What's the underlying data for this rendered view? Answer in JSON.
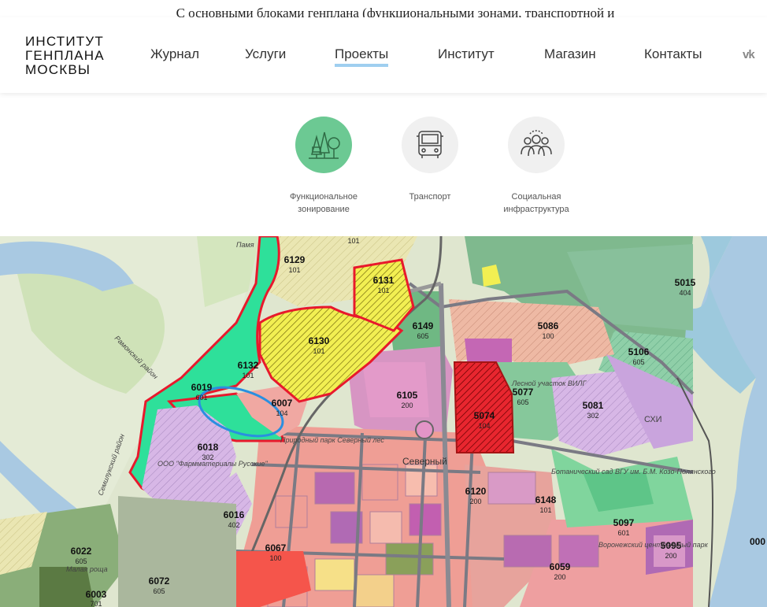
{
  "intro_text": "С основными блоками генплана (функциональными зонами, транспортной и",
  "logo": {
    "line1": "ИНСТИТУТ",
    "line2": "ГЕНПЛАНА",
    "line3": "МОСКВЫ"
  },
  "nav": [
    {
      "label": "Журнал",
      "active": false
    },
    {
      "label": "Услуги",
      "active": false
    },
    {
      "label": "Проекты",
      "active": true
    },
    {
      "label": "Институт",
      "active": false
    },
    {
      "label": "Магазин",
      "active": false
    },
    {
      "label": "Контакты",
      "active": false
    }
  ],
  "social": {
    "vk": "vk-icon"
  },
  "categories": [
    {
      "label": "Функциональное\nзонирование",
      "icon": "forest-icon",
      "active": true
    },
    {
      "label": "Транспорт",
      "icon": "bus-icon",
      "active": false
    },
    {
      "label": "Социальная\nинфраструктура",
      "icon": "people-icon",
      "active": false
    }
  ],
  "colors": {
    "active_category": "#6cc993",
    "nav_underline": "#9fcff0",
    "zone_highlight_border": "#e8192c"
  },
  "map": {
    "zones": [
      {
        "id": "6129",
        "code": "101"
      },
      {
        "id": "6131",
        "code": "101"
      },
      {
        "id": "6130",
        "code": "101"
      },
      {
        "id": "6149",
        "code": "605"
      },
      {
        "id": "5086",
        "code": "100"
      },
      {
        "id": "5015",
        "code": "404"
      },
      {
        "id": "5106",
        "code": "605"
      },
      {
        "id": "6132",
        "code": "101"
      },
      {
        "id": "6019",
        "code": "601"
      },
      {
        "id": "6007",
        "code": "104"
      },
      {
        "id": "6105",
        "code": "200"
      },
      {
        "id": "5077",
        "code": "605"
      },
      {
        "id": "5074",
        "code": "104"
      },
      {
        "id": "5081",
        "code": "302"
      },
      {
        "id": "6018",
        "code": "302"
      },
      {
        "id": "6120",
        "code": "200"
      },
      {
        "id": "6148",
        "code": "101"
      },
      {
        "id": "6016",
        "code": "402"
      },
      {
        "id": "5097",
        "code": "601"
      },
      {
        "id": "5095",
        "code": "200"
      },
      {
        "id": "6067",
        "code": "100"
      },
      {
        "id": "6022",
        "code": "605"
      },
      {
        "id": "6072",
        "code": "605"
      },
      {
        "id": "6003",
        "code": "701"
      },
      {
        "id": "6059",
        "code": "200"
      },
      {
        "id": "000",
        "code": ""
      }
    ],
    "top_code": "101",
    "places": {
      "severny": "Северный",
      "park": "Природный парк Северный лес",
      "botanic": "Ботанический сад ВГУ им. Б.М. Козо-Полянского",
      "forest_section": "Лесной участок ВИЛГ",
      "voronezh_park": "Воронежский центральный парк",
      "ramon_road": "Рамонский район",
      "semiluk_road": "Семилукский район",
      "ooo": "ООО \"Фармматериалы Русские\"",
      "pamyat": "Памя",
      "malaya": "Малая роща",
      "skh": "СХИ"
    }
  }
}
